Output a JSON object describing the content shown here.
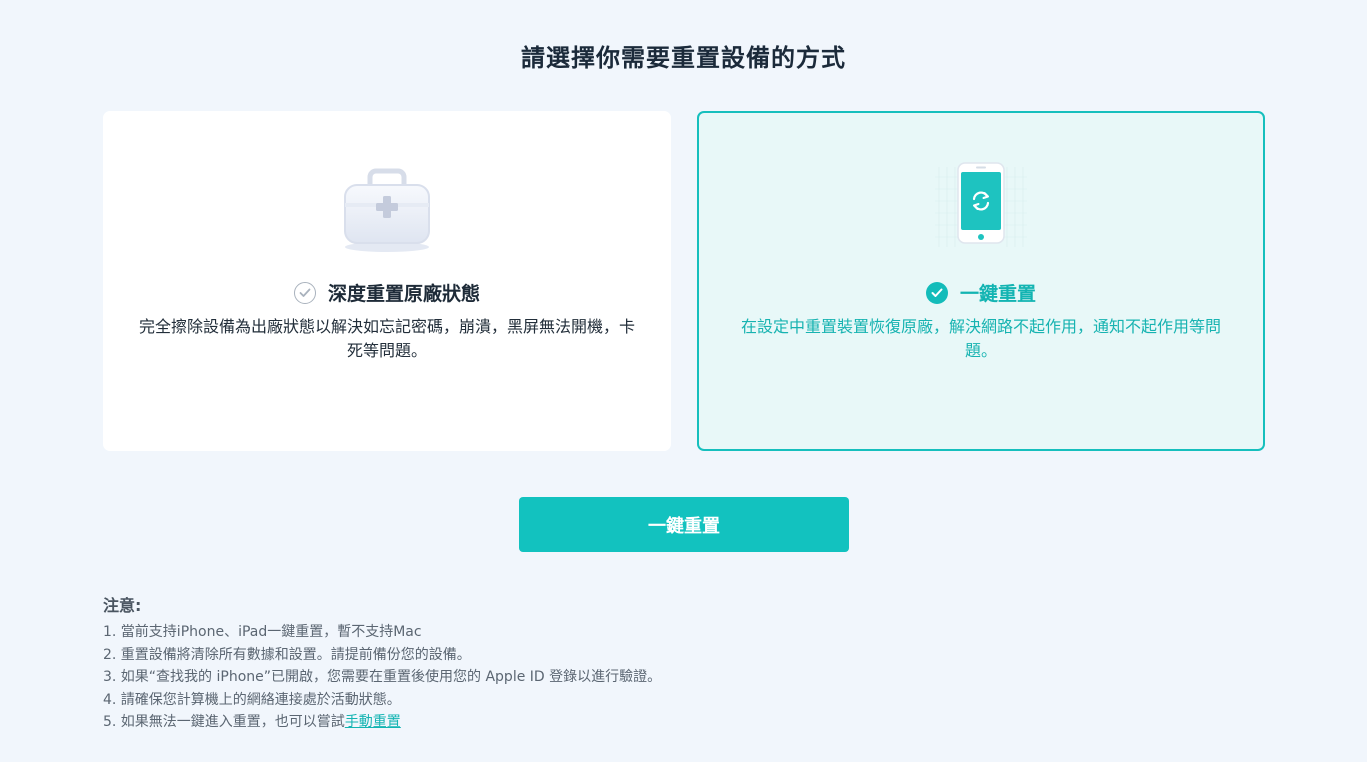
{
  "header": {
    "title": "請選擇你需要重置設備的方式"
  },
  "options": {
    "deep_reset": {
      "title": "深度重置原廠狀態",
      "description": "完全擦除設備為出廠狀態以解決如忘記密碼，崩潰，黑屏無法開機，卡死等問題。",
      "selected": false,
      "icon": "first-aid-kit-icon"
    },
    "one_key_reset": {
      "title": "一鍵重置",
      "description": "在設定中重置裝置恢復原廠，解決網路不起作用，通知不起作用等問題。",
      "selected": true,
      "icon": "phone-reset-icon"
    }
  },
  "action": {
    "button_label": "一鍵重置"
  },
  "notes": {
    "title": "注意:",
    "items": [
      "1. 當前支持iPhone、iPad一鍵重置，暫不支持Mac",
      "2. 重置設備將清除所有數據和設置。請提前備份您的設備。",
      "3. 如果“查找我的 iPhone”已開啟，您需要在重置後使用您的 Apple ID 登錄以進行驗證。",
      "4. 請確保您計算機上的網絡連接處於活動狀態。"
    ],
    "last_item_prefix": "5. 如果無法一鍵進入重置，也可以嘗試",
    "last_item_link": "手動重置"
  },
  "colors": {
    "accent": "#12c2bf",
    "background": "#f1f6fc",
    "selected_card_bg": "#e8f8f8"
  }
}
